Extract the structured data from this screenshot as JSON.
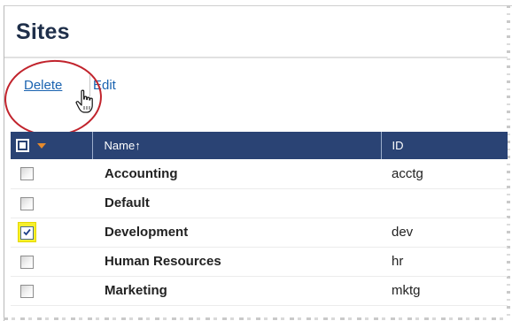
{
  "page": {
    "title": "Sites"
  },
  "actions": {
    "delete_label": "Delete",
    "edit_label": "Edit"
  },
  "table": {
    "columns": {
      "name": "Name",
      "sort_indicator": "↑",
      "id": "ID"
    },
    "rows": [
      {
        "name": "Accounting",
        "id": "acctg",
        "checked": false
      },
      {
        "name": "Default",
        "id": "",
        "checked": false
      },
      {
        "name": "Development",
        "id": "dev",
        "checked": true
      },
      {
        "name": "Human Resources",
        "id": "hr",
        "checked": false
      },
      {
        "name": "Marketing",
        "id": "mktg",
        "checked": false
      }
    ]
  },
  "colors": {
    "header_bg": "#2a4374",
    "link": "#1a63b0",
    "row_name": "#1f3e7a",
    "annotation_ring": "#c1232c",
    "selected_highlight": "#f6ef2d"
  },
  "icons": {
    "cursor": "hand-pointer-icon",
    "sort": "sort-ascending-icon",
    "header_menu": "dropdown-arrow-icon"
  }
}
